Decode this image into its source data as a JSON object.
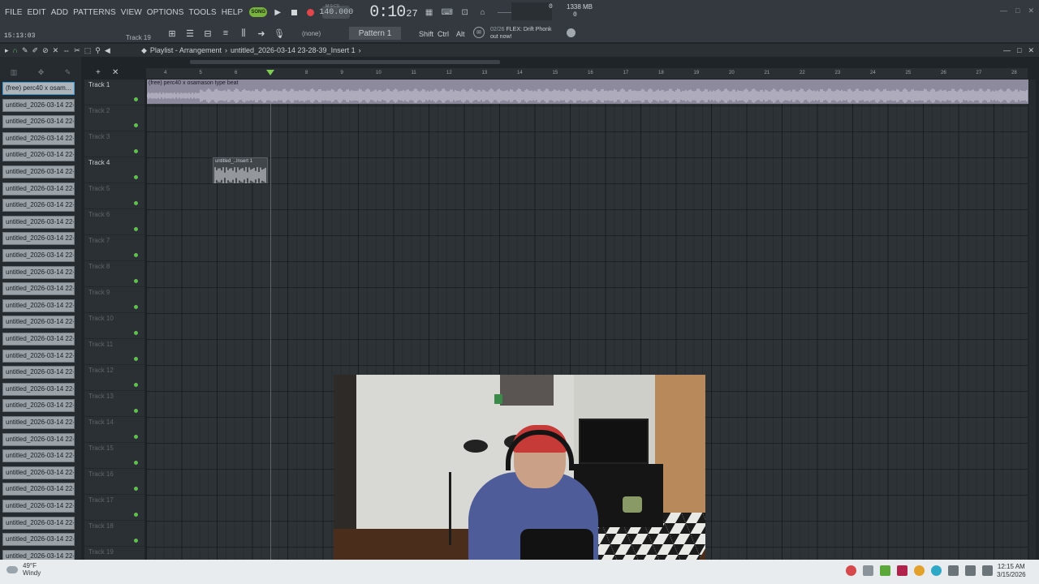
{
  "menu": [
    "FILE",
    "EDIT",
    "ADD",
    "PATTERNS",
    "VIEW",
    "OPTIONS",
    "TOOLS",
    "HELP"
  ],
  "transport": {
    "mode_badge": "SONG",
    "tempo": "140.000",
    "time_main": "0:10",
    "time_sub": "27",
    "time_label": "M:S:CS"
  },
  "cpu": {
    "value_a": "0",
    "value_b": "0",
    "memory": "1338 MB"
  },
  "secondbar": {
    "clock": "15:13:03",
    "track_label": "Track 19",
    "none_label": "(none)",
    "pattern": "Pattern 1",
    "modifiers": [
      "Shift",
      "Ctrl",
      "Alt"
    ],
    "hint_num": "02/26",
    "hint_line1": "FLEX: Drift Phonk",
    "hint_line2": "out now!"
  },
  "playlist": {
    "title": "Playlist - Arrangement",
    "project": "untitled_2026-03-14 23-28-39_Insert 1",
    "separator": "›"
  },
  "picker_clips": [
    "(free) perc40 x osam...",
    "untitled_2026-03-14 22-...",
    "untitled_2026-03-14 22-...",
    "untitled_2026-03-14 22-...",
    "untitled_2026-03-14 22-...",
    "untitled_2026-03-14 22-...",
    "untitled_2026-03-14 22-...",
    "untitled_2026-03-14 22-...",
    "untitled_2026-03-14 22-...",
    "untitled_2026-03-14 22-...",
    "untitled_2026-03-14 22-...",
    "untitled_2026-03-14 22-...",
    "untitled_2026-03-14 22-...",
    "untitled_2026-03-14 22-...",
    "untitled_2026-03-14 22-...",
    "untitled_2026-03-14 22-...",
    "untitled_2026-03-14 22-...",
    "untitled_2026-03-14 22-...",
    "untitled_2026-03-14 22-...",
    "untitled_2026-03-14 22-...",
    "untitled_2026-03-14 22-...",
    "untitled_2026-03-14 22-...",
    "untitled_2026-03-14 22-...",
    "untitled_2026-03-14 22-...",
    "untitled_2026-03-14 22-...",
    "untitled_2026-03-14 22-...",
    "untitled_2026-03-14 22-...",
    "untitled_2026-03-14 22-...",
    "untitled_2026-03-14 22-..."
  ],
  "tracks": [
    "Track 1",
    "Track 2",
    "Track 3",
    "Track 4",
    "Track 5",
    "Track 6",
    "Track 7",
    "Track 8",
    "Track 9",
    "Track 10",
    "Track 11",
    "Track 12",
    "Track 13",
    "Track 14",
    "Track 15",
    "Track 16",
    "Track 17",
    "Track 18",
    "Track 19"
  ],
  "active_tracks": [
    1,
    4
  ],
  "ruler_bars": [
    "4",
    "5",
    "6",
    "7",
    "8",
    "9",
    "10",
    "11",
    "12",
    "13",
    "14",
    "15",
    "16",
    "17",
    "18",
    "19",
    "20",
    "21",
    "22",
    "23",
    "24",
    "25",
    "26",
    "27",
    "28"
  ],
  "arranged_clips": {
    "audio1": "(free) perc40 x osamason type beat",
    "audio2": "untitled_..Insert 1"
  },
  "taskbar": {
    "temp": "49°F",
    "weather": "Windy",
    "time": "12:15 AM",
    "date": "3/15/2026"
  },
  "colors": {
    "accent_green": "#61c04b",
    "record_red": "#e2454a",
    "clip_lilac": "#8d8a9d",
    "selection_blue": "#3d9ad6"
  }
}
